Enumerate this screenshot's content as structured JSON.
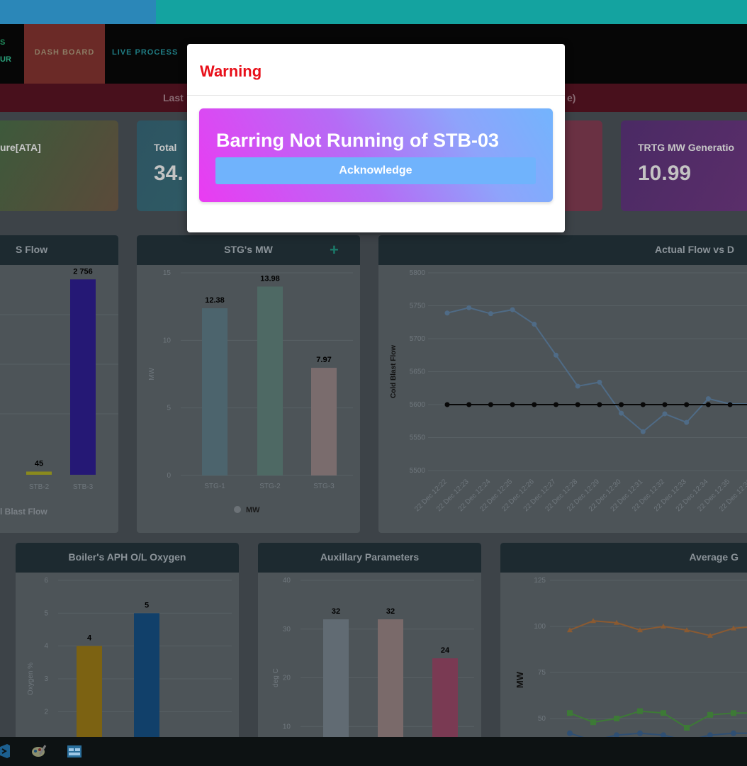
{
  "nav": {
    "logo_top": "S",
    "logo_bottom": "UR",
    "dashboard": "DASH BOARD",
    "live_process": "LIVE PROCESS"
  },
  "banner": {
    "left_text": "Last",
    "right_text": "e)"
  },
  "kpis": [
    {
      "label": "ure[ATA]",
      "value": ""
    },
    {
      "label": "Total",
      "value": "34."
    },
    {
      "label": "TRTG MW Generatio",
      "value": "10.99"
    }
  ],
  "panels": {
    "cbf_flow": {
      "title": "S Flow",
      "legend": "l Blast Flow",
      "chart_data": {
        "type": "bar",
        "categories": [
          "STB-2",
          "STB-3"
        ],
        "values": [
          45,
          2756
        ],
        "labels": [
          "45",
          "2 756"
        ],
        "colors": [
          "#8a8a1d",
          "#251875"
        ]
      }
    },
    "stg_mw": {
      "title": "STG's MW",
      "add_icon": "plus-icon",
      "legend": "MW",
      "chart_data": {
        "type": "bar",
        "categories": [
          "STG-1",
          "STG-2",
          "STG-3"
        ],
        "values": [
          12.38,
          13.98,
          7.97
        ],
        "ylabel": "MW",
        "ylim": [
          0,
          15
        ],
        "yticks": [
          "0",
          "5",
          "10",
          "15"
        ],
        "colors": [
          "#4c646d",
          "#4e6964",
          "#7a6c6d"
        ]
      }
    },
    "actual_flow": {
      "title": "Actual Flow vs D",
      "chart_data": {
        "type": "line",
        "ylabel": "Cold Blast Flow",
        "ylim": [
          5500,
          5800
        ],
        "yticks": [
          "5500",
          "5550",
          "5600",
          "5650",
          "5700",
          "5750",
          "5800"
        ],
        "x": [
          "22 Dec 12:22",
          "22 Dec 12:23",
          "22 Dec 12:24",
          "22 Dec 12:25",
          "22 Dec 12:26",
          "22 Dec 12:27",
          "22 Dec 12:28",
          "22 Dec 12:29",
          "22 Dec 12:30",
          "22 Dec 12:31",
          "22 Dec 12:32",
          "22 Dec 12:33",
          "22 Dec 12:34",
          "22 Dec 12:35",
          "22 Dec 12:36"
        ],
        "series": [
          {
            "values": [
              5739,
              5747,
              5738,
              5744,
              5722,
              5675,
              5628,
              5634,
              5587,
              5559,
              5586,
              5573,
              5609,
              5601,
              5601
            ],
            "color": "#4f6b86"
          },
          {
            "values": [
              5600,
              5600,
              5600,
              5600,
              5600,
              5600,
              5600,
              5600,
              5600,
              5600,
              5600,
              5600,
              5600,
              5600,
              5600
            ],
            "color": "#080808"
          }
        ]
      }
    },
    "boiler_oxygen": {
      "title": "Boiler's APH O/L Oxygen",
      "chart_data": {
        "type": "bar",
        "categories": [
          "",
          ""
        ],
        "values": [
          4,
          5
        ],
        "ylabel": "Oxygen %",
        "ylim": [
          0,
          6
        ],
        "yticks": [
          "2",
          "3",
          "4",
          "5",
          "6"
        ],
        "colors": [
          "#7c6212",
          "#11406a"
        ]
      }
    },
    "aux_params": {
      "title": "Auxillary Parameters",
      "chart_data": {
        "type": "bar",
        "categories": [
          "",
          "",
          ""
        ],
        "values": [
          32,
          32,
          24
        ],
        "ylabel": "deg C",
        "ylim": [
          0,
          40
        ],
        "yticks": [
          "10",
          "20",
          "30",
          "40"
        ],
        "colors": [
          "#616b73",
          "#7a6a6a",
          "#7a3a53"
        ]
      }
    },
    "average": {
      "title": "Average G",
      "chart_data": {
        "type": "line",
        "ylabel": "MW",
        "ylim": [
          40,
          125
        ],
        "yticks": [
          "50",
          "75",
          "100",
          "125"
        ],
        "series": [
          {
            "values": [
              98,
              103,
              102,
              98,
              100,
              98,
              95,
              99,
              100
            ],
            "color": "#8a5a32"
          },
          {
            "values": [
              53,
              48,
              50,
              54,
              53,
              45,
              52,
              53,
              53
            ],
            "color": "#3d7a36"
          },
          {
            "values": [
              42,
              38,
              41,
              42,
              41,
              38,
              41,
              42,
              42
            ],
            "color": "#2f4f73"
          }
        ]
      }
    }
  },
  "modal": {
    "title": "Warning",
    "message": "Barring Not Running of STB-03",
    "acknowledge": "Acknowledge"
  },
  "colors": {
    "warning_title": "#e8101a",
    "ack_button": "#70b3fc"
  },
  "taskbar": {
    "icons": [
      "vscode-icon",
      "paint-icon",
      "app-window-icon"
    ]
  }
}
